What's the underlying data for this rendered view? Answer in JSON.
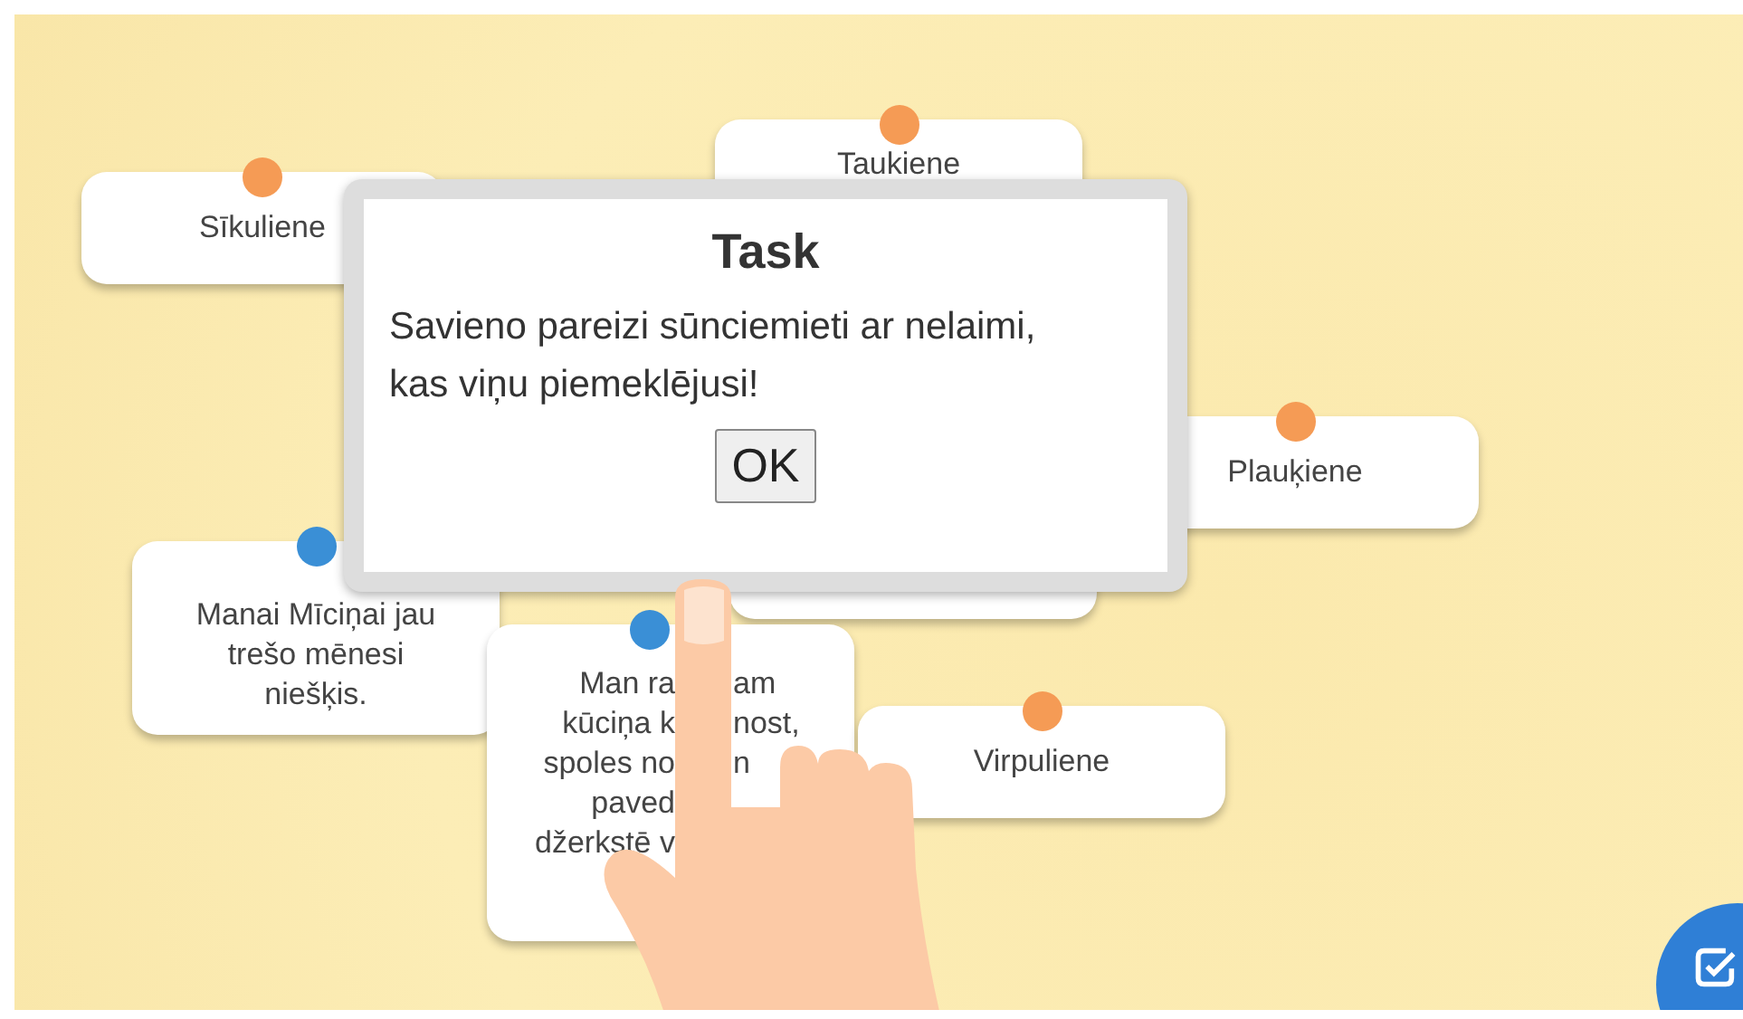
{
  "cards": [
    {
      "color": "#f59b55",
      "lines": [
        [
          "Sīkuliene"
        ]
      ]
    },
    {
      "color": "#f59b55",
      "lines": [
        [
          "Taukiene"
        ]
      ]
    },
    {
      "color": "#f59b55",
      "lines": [
        [
          "Plauķiene"
        ]
      ]
    },
    {
      "color": "#3a8fd6",
      "lines": [
        [
          "Manai Mīciņai jau"
        ],
        [
          "trešo mēnesi"
        ],
        [
          "niešķis."
        ]
      ]
    },
    {
      "color": "#3a8fd6",
      "lines": [
        [
          "Man ra",
          "am"
        ],
        [
          "kūciņa k",
          "nost,"
        ],
        [
          "spoles no",
          "n"
        ],
        [
          "paved"
        ],
        [
          "džerkstē v"
        ]
      ]
    },
    {
      "color": "#f59b55",
      "lines": [
        [
          "Virpuliene"
        ]
      ]
    }
  ],
  "dialog": {
    "title": "Task",
    "message": "Savieno pareizi sūnciemieti ar nelaimi, kas viņu piemeklējusi!",
    "button": "OK"
  }
}
